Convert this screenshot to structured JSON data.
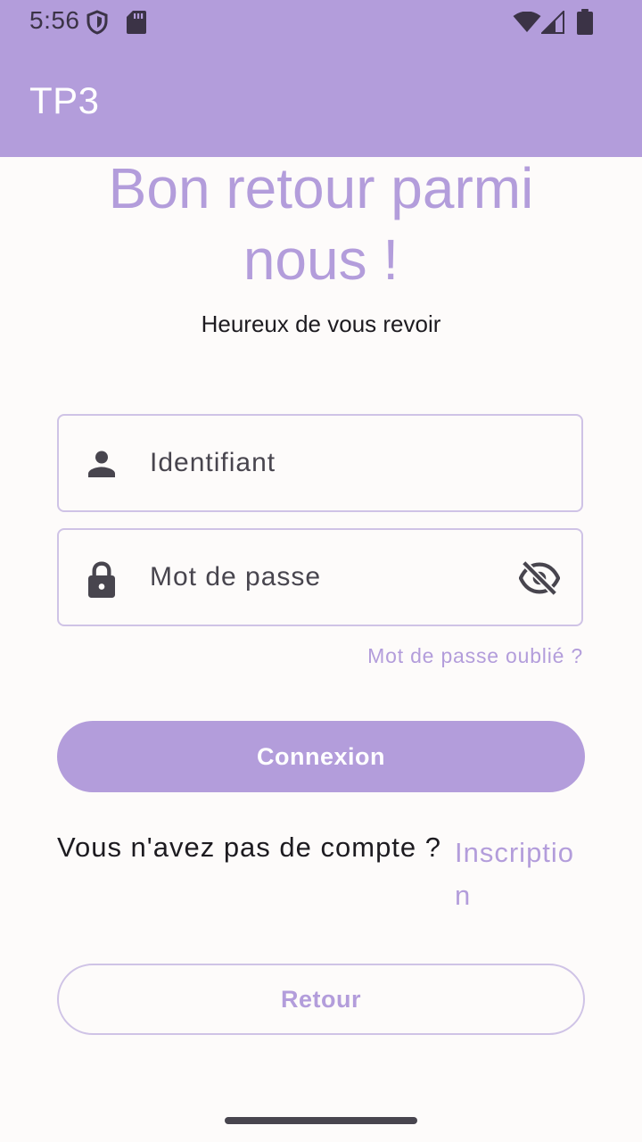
{
  "status_bar": {
    "time": "5:56"
  },
  "app_bar": {
    "title": "TP3"
  },
  "login": {
    "heading": "Bon retour parmi nous !",
    "subtitle": "Heureux de vous revoir",
    "username_field": {
      "label": "Identifiant",
      "icon": "person-icon"
    },
    "password_field": {
      "label": "Mot de passe",
      "icon": "lock-icon",
      "toggle_icon": "visibility-off-icon"
    },
    "forgot_password": "Mot de passe oublié ?",
    "login_button": "Connexion",
    "no_account_text": "Vous n'avez pas de compte ?",
    "signup_link": "Inscription",
    "back_button": "Retour"
  },
  "colors": {
    "primary": "#b39ddb",
    "outline": "#cfc3e6",
    "background": "#fdfbfa",
    "text": "#1d1b20"
  }
}
